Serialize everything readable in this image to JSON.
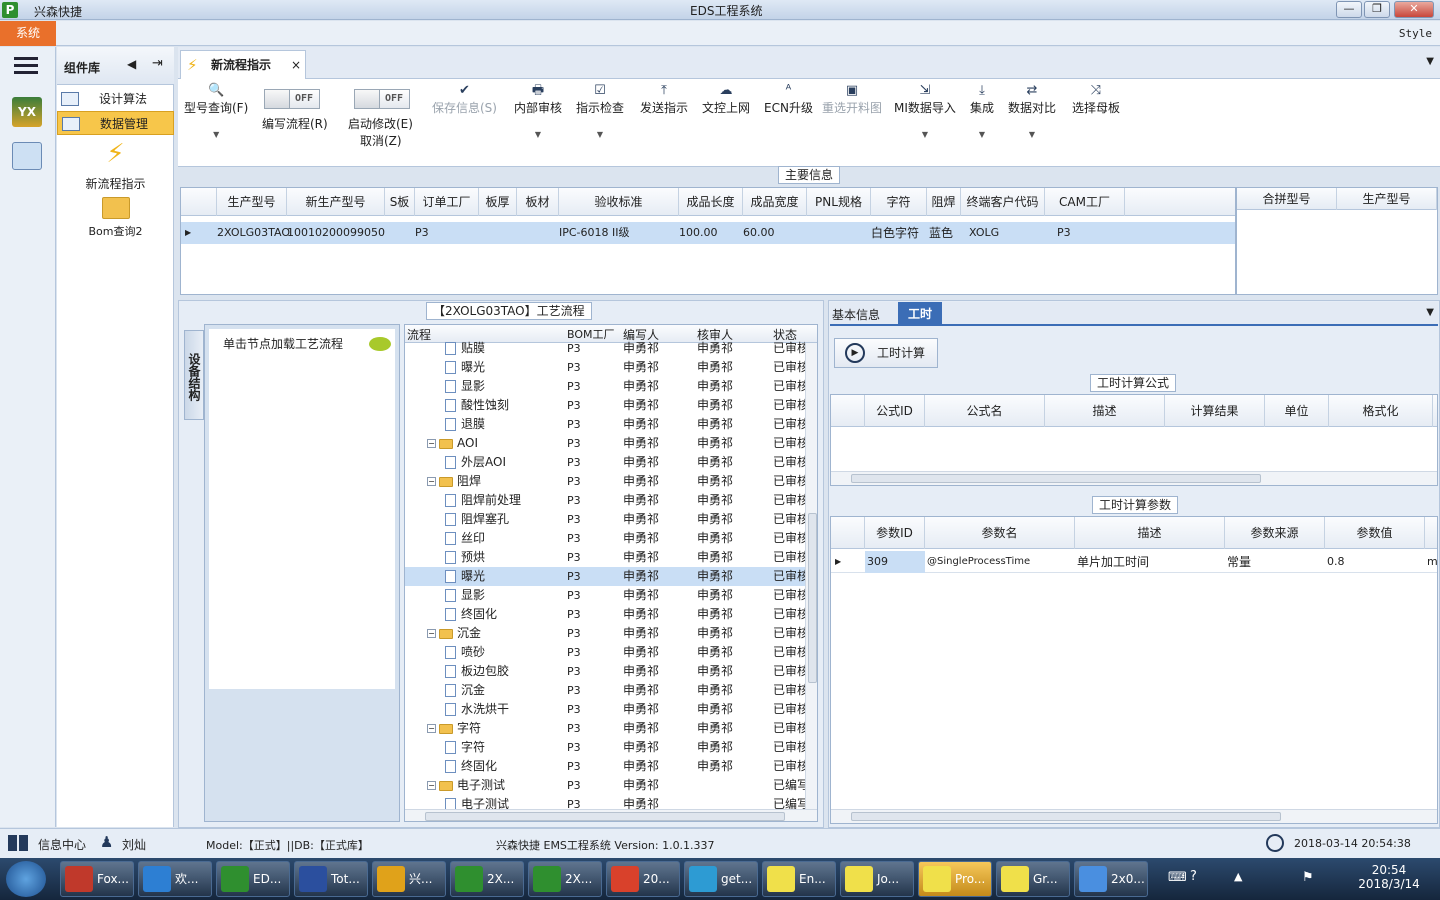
{
  "titlebar": {
    "app_name": "兴森快捷",
    "window_title": "EDS工程系统",
    "min": "—",
    "max": "❐",
    "close": "✕"
  },
  "menubar": {
    "system": "系统",
    "style": "Style"
  },
  "panel": {
    "title": "组件库",
    "items": [
      {
        "label": "设计算法"
      },
      {
        "label": "数据管理"
      }
    ],
    "big_items": [
      {
        "label": "新流程指示"
      },
      {
        "label": "Bom查询2"
      }
    ]
  },
  "doc_tab": {
    "label": "新流程指示",
    "close": "×"
  },
  "ribbon": {
    "buttons": [
      {
        "label": "型号查询(F)"
      },
      {
        "label": "编写流程(R)",
        "toggle": "OFF"
      },
      {
        "label": "启动修改(E)",
        "sub": "取消(Z)",
        "toggle": "OFF"
      },
      {
        "label": "保存信息(S)"
      },
      {
        "label": "内部审核"
      },
      {
        "label": "指示检查"
      },
      {
        "label": "发送指示"
      },
      {
        "label": "文控上网"
      },
      {
        "label": "ECN升级"
      },
      {
        "label": "重选开料图"
      },
      {
        "label": "MI数据导入"
      },
      {
        "label": "集成"
      },
      {
        "label": "数据对比"
      },
      {
        "label": "选择母板"
      }
    ]
  },
  "main_info": {
    "label": "主要信息",
    "columns": [
      "生产型号",
      "新生产型号",
      "S板",
      "订单工厂",
      "板厚",
      "板材",
      "验收标准",
      "成品长度",
      "成品宽度",
      "PNL规格",
      "字符",
      "阻焊",
      "终端客户代码",
      "CAM工厂"
    ],
    "row": [
      "2XOLG03TAO",
      "10010200099050",
      "",
      "P3",
      "",
      "",
      "IPC-6018 II级",
      "100.00",
      "60.00",
      "",
      "白色字符",
      "蓝色",
      "XOLG",
      "P3"
    ],
    "side_columns": [
      "合拼型号",
      "生产型号"
    ]
  },
  "process": {
    "label": "【2XOLG03TAO】工艺流程",
    "side_tab": "设备结构",
    "hint": "单击节点加载工艺流程",
    "columns": [
      "流程",
      "BOM工厂",
      "编写人",
      "核审人",
      "状态"
    ],
    "rows": [
      {
        "name": "贴膜",
        "type": "doc",
        "f": "P3",
        "w": "申勇祁",
        "r": "申勇祁",
        "s": "已审核"
      },
      {
        "name": "曝光",
        "type": "doc",
        "f": "P3",
        "w": "申勇祁",
        "r": "申勇祁",
        "s": "已审核"
      },
      {
        "name": "显影",
        "type": "doc",
        "f": "P3",
        "w": "申勇祁",
        "r": "申勇祁",
        "s": "已审核"
      },
      {
        "name": "酸性蚀刻",
        "type": "doc",
        "f": "P3",
        "w": "申勇祁",
        "r": "申勇祁",
        "s": "已审核"
      },
      {
        "name": "退膜",
        "type": "doc",
        "f": "P3",
        "w": "申勇祁",
        "r": "申勇祁",
        "s": "已审核"
      },
      {
        "name": "AOI",
        "type": "folder",
        "f": "P3",
        "w": "申勇祁",
        "r": "申勇祁",
        "s": "已审核"
      },
      {
        "name": "外层AOI",
        "type": "doc",
        "f": "P3",
        "w": "申勇祁",
        "r": "申勇祁",
        "s": "已审核"
      },
      {
        "name": "阻焊",
        "type": "folder",
        "f": "P3",
        "w": "申勇祁",
        "r": "申勇祁",
        "s": "已审核"
      },
      {
        "name": "阻焊前处理",
        "type": "doc",
        "f": "P3",
        "w": "申勇祁",
        "r": "申勇祁",
        "s": "已审核"
      },
      {
        "name": "阻焊塞孔",
        "type": "doc",
        "f": "P3",
        "w": "申勇祁",
        "r": "申勇祁",
        "s": "已审核"
      },
      {
        "name": "丝印",
        "type": "doc",
        "f": "P3",
        "w": "申勇祁",
        "r": "申勇祁",
        "s": "已审核"
      },
      {
        "name": "预烘",
        "type": "doc",
        "f": "P3",
        "w": "申勇祁",
        "r": "申勇祁",
        "s": "已审核"
      },
      {
        "name": "曝光",
        "type": "doc",
        "f": "P3",
        "w": "申勇祁",
        "r": "申勇祁",
        "s": "已审核",
        "sel": true
      },
      {
        "name": "显影",
        "type": "doc",
        "f": "P3",
        "w": "申勇祁",
        "r": "申勇祁",
        "s": "已审核"
      },
      {
        "name": "终固化",
        "type": "doc",
        "f": "P3",
        "w": "申勇祁",
        "r": "申勇祁",
        "s": "已审核"
      },
      {
        "name": "沉金",
        "type": "folder",
        "f": "P3",
        "w": "申勇祁",
        "r": "申勇祁",
        "s": "已审核"
      },
      {
        "name": "喷砂",
        "type": "doc",
        "f": "P3",
        "w": "申勇祁",
        "r": "申勇祁",
        "s": "已审核"
      },
      {
        "name": "板边包胶",
        "type": "doc",
        "f": "P3",
        "w": "申勇祁",
        "r": "申勇祁",
        "s": "已审核"
      },
      {
        "name": "沉金",
        "type": "doc",
        "f": "P3",
        "w": "申勇祁",
        "r": "申勇祁",
        "s": "已审核"
      },
      {
        "name": "水洗烘干",
        "type": "doc",
        "f": "P3",
        "w": "申勇祁",
        "r": "申勇祁",
        "s": "已审核"
      },
      {
        "name": "字符",
        "type": "folder",
        "f": "P3",
        "w": "申勇祁",
        "r": "申勇祁",
        "s": "已审核"
      },
      {
        "name": "字符",
        "type": "doc",
        "f": "P3",
        "w": "申勇祁",
        "r": "申勇祁",
        "s": "已审核"
      },
      {
        "name": "终固化",
        "type": "doc",
        "f": "P3",
        "w": "申勇祁",
        "r": "申勇祁",
        "s": "已审核"
      },
      {
        "name": "电子测试",
        "type": "folder",
        "f": "P3",
        "w": "申勇祁",
        "r": "",
        "s": "已编写"
      },
      {
        "name": "电子测试",
        "type": "doc",
        "f": "P3",
        "w": "申勇祁",
        "r": "",
        "s": "已编写"
      }
    ]
  },
  "right": {
    "tabs": [
      "基本信息",
      "工时"
    ],
    "calc_button": "工时计算",
    "formula": {
      "label": "工时计算公式",
      "columns": [
        "公式ID",
        "公式名",
        "描述",
        "计算结果",
        "单位",
        "格式化"
      ]
    },
    "params": {
      "label": "工时计算参数",
      "columns": [
        "参数ID",
        "参数名",
        "描述",
        "参数来源",
        "参数值"
      ],
      "row": [
        "309",
        "@SingleProcessTime",
        "单片加工时间",
        "常量",
        "0.8",
        "mi"
      ]
    }
  },
  "statusbar": {
    "info_center": "信息中心",
    "user": "刘灿",
    "model": "Model:【正式】||DB:【正式库】",
    "app": "兴森快捷 EMS工程系统 Version: 1.0.1.337",
    "datetime": "2018-03-14 20:54:38"
  },
  "taskbar": {
    "items": [
      {
        "label": "Fox..."
      },
      {
        "label": "欢..."
      },
      {
        "label": "ED..."
      },
      {
        "label": "Tot..."
      },
      {
        "label": "兴..."
      },
      {
        "label": "2X..."
      },
      {
        "label": "2X..."
      },
      {
        "label": "20..."
      },
      {
        "label": "get..."
      },
      {
        "label": "En..."
      },
      {
        "label": "Jo..."
      },
      {
        "label": "Pro..."
      },
      {
        "label": "Gr..."
      },
      {
        "label": "2x0..."
      }
    ],
    "clock_time": "20:54",
    "clock_date": "2018/3/14"
  }
}
